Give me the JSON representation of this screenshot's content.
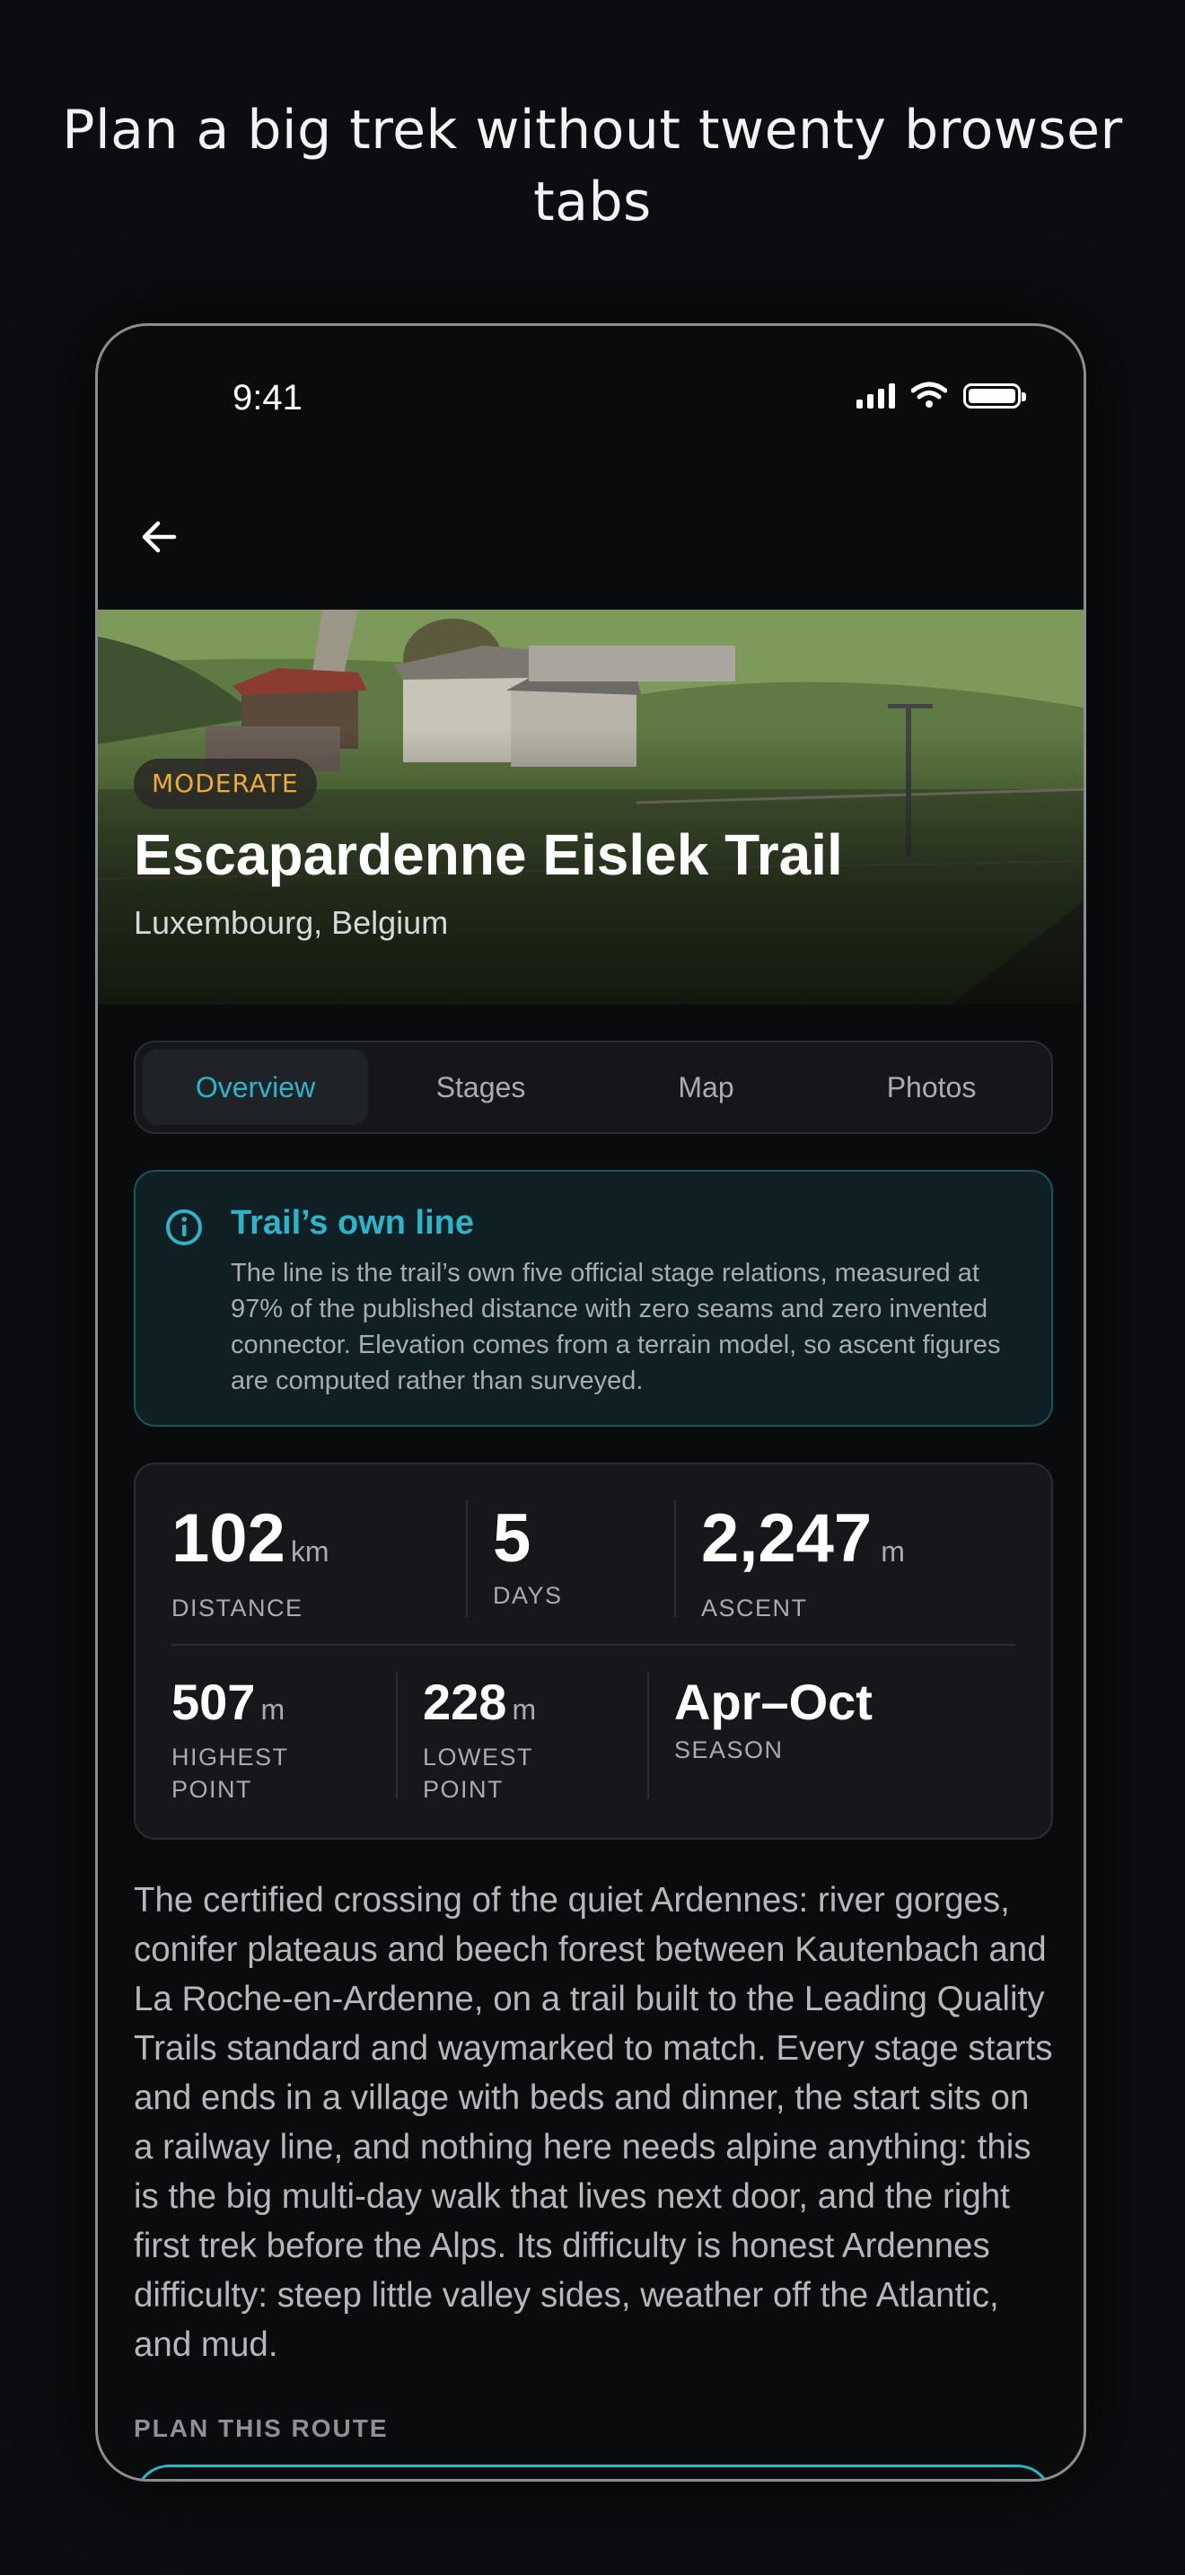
{
  "headline": "Plan a big trek without twenty browser tabs",
  "status_bar": {
    "time": "9:41"
  },
  "hero": {
    "difficulty": "MODERATE",
    "title": "Escapardenne Eislek Trail",
    "location": "Luxembourg, Belgium"
  },
  "tabs": [
    {
      "label": "Overview",
      "active": true
    },
    {
      "label": "Stages",
      "active": false
    },
    {
      "label": "Map",
      "active": false
    },
    {
      "label": "Photos",
      "active": false
    }
  ],
  "note": {
    "title": "Trail’s own line",
    "body": "The line is the trail’s own five official stage relations, measured at 97% of the published distance with zero seams and zero invented connector. Elevation comes from a terrain model, so ascent figures are computed rather than surveyed."
  },
  "stats": {
    "distance": {
      "value": "102",
      "unit": "km",
      "label": "DISTANCE"
    },
    "days": {
      "value": "5",
      "unit": "",
      "label": "DAYS"
    },
    "ascent": {
      "value": "2,247",
      "unit": "m",
      "label": "ASCENT"
    },
    "highest": {
      "value": "507",
      "unit": "m",
      "label_line1": "HIGHEST",
      "label_line2": "POINT"
    },
    "lowest": {
      "value": "228",
      "unit": "m",
      "label_line1": "LOWEST",
      "label_line2": "POINT"
    },
    "season": {
      "value": "Apr–Oct",
      "label": "SEASON"
    }
  },
  "description": "The certified crossing of the quiet Ardennes: river gorges, conifer plateaus and beech forest between Kautenbach and La Roche-en-Ardenne, on a trail built to the Leading Quality Trails standard and waymarked to match. Every stage starts and ends in a village with beds and dinner, the start sits on a railway line, and nothing here needs alpine anything: this is the big multi-day walk that lives next door, and the right first trek before the Alps. Its difficulty is honest Ardennes difficulty: steep little valley sides, weather off the Atlantic, and mud.",
  "plan_heading": "PLAN THIS ROUTE",
  "colors": {
    "accent": "#2bb5c8",
    "badge": "#f2a93b",
    "background": "#0b0d10"
  }
}
